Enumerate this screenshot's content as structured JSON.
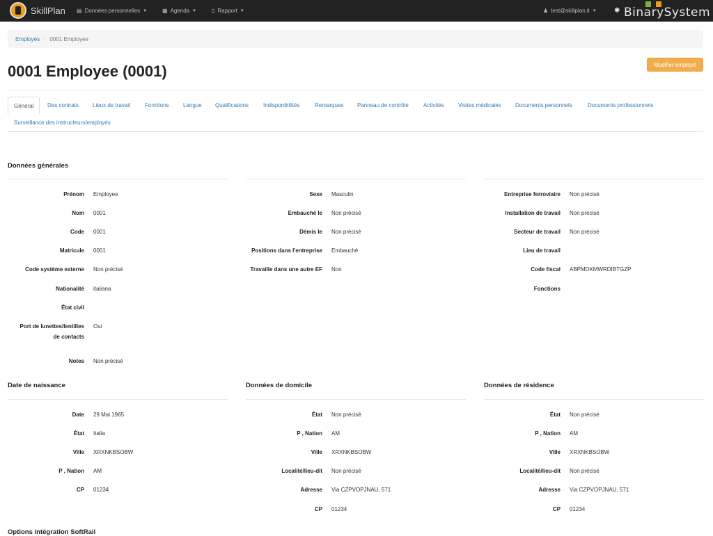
{
  "nav": {
    "brand": "SkillPlan",
    "menus": [
      {
        "icon": "id-card-icon",
        "label": "Données personnelles"
      },
      {
        "icon": "calendar-icon",
        "label": "Agenda"
      },
      {
        "icon": "report-icon",
        "label": "Rapport"
      }
    ],
    "user": "test@skillplan.it",
    "company_logo": "BinarySystem"
  },
  "breadcrumb": {
    "parent": "Employés",
    "separator": "/",
    "current": "0001 Employee"
  },
  "page": {
    "title": "0001 Employee (0001)",
    "edit_button": "Modifier employé"
  },
  "tabs": [
    "Général",
    "Des contrats",
    "Lieux de travail",
    "Fonctions",
    "Langue",
    "Qualifications",
    "Indisponibilités",
    "Remarques",
    "Panneau de contrôle",
    "Activités",
    "Visites médicales",
    "Documents personnels",
    "Documents professionnels",
    "Surveillance des instructeurs/employés"
  ],
  "active_tab": "Général",
  "general": {
    "heading": "Données générales",
    "col1": [
      {
        "label": "Prénom",
        "value": "Employee"
      },
      {
        "label": "Nom",
        "value": "0001"
      },
      {
        "label": "Code",
        "value": "0001"
      },
      {
        "label": "Matricule",
        "value": "0001"
      },
      {
        "label": "Code système externe",
        "value": "Non précisé"
      },
      {
        "label": "Nationalité",
        "value": "italiana"
      },
      {
        "label": "État civil",
        "value": ""
      },
      {
        "label": "Port de lunettes/lentilles",
        "label2": "de contacts",
        "value": "Oui"
      },
      {
        "label": "Notes",
        "value": "Non précisé"
      }
    ],
    "col2": [
      {
        "label": "Sexe",
        "value": "Masculin"
      },
      {
        "label": "Embauché le",
        "value": "Non précisé"
      },
      {
        "label": "Démis le",
        "value": "Non précisé"
      },
      {
        "label": "Positions dans l'entreprise",
        "value": "Embauché"
      },
      {
        "label": "Travaille dans une autre EF",
        "value": "Non"
      }
    ],
    "col3": [
      {
        "label": "Entreprise ferroviaire",
        "value": "Non précisé"
      },
      {
        "label": "Installation de travail",
        "value": "Non précisé"
      },
      {
        "label": "Secteur de travail",
        "value": "Non précisé"
      },
      {
        "label": "Lieu de travail",
        "value": ""
      },
      {
        "label": "Code fiscal",
        "value": "ABPMDKMWRDIBTGZP"
      },
      {
        "label": "Fonctions",
        "value": ""
      }
    ]
  },
  "birth": {
    "heading": "Date de naissance",
    "rows": [
      {
        "label": "Date",
        "value": "29 Mai 1965"
      },
      {
        "label": "État",
        "value": "Italia"
      },
      {
        "label": "Ville",
        "value": "XRXNKBSOBW"
      },
      {
        "label": "P , Nation",
        "value": "AM"
      },
      {
        "label": "CP",
        "value": "01234"
      }
    ]
  },
  "domicile": {
    "heading": "Données de domicile",
    "rows": [
      {
        "label": "État",
        "value": "Non précisé"
      },
      {
        "label": "P , Nation",
        "value": "AM"
      },
      {
        "label": "Ville",
        "value": "XRXNKBSOBW"
      },
      {
        "label": "Localité/lieu-dit",
        "value": "Non précisé"
      },
      {
        "label": "Adresse",
        "value": "Via CZPVOPJNAU, 571"
      },
      {
        "label": "CP",
        "value": "01234"
      }
    ]
  },
  "residence": {
    "heading": "Données de résidence",
    "rows": [
      {
        "label": "État",
        "value": "Non précisé"
      },
      {
        "label": "P , Nation",
        "value": "AM"
      },
      {
        "label": "Ville",
        "value": "XRXNKBSOBW"
      },
      {
        "label": "Localité/lieu-dit",
        "value": "Non précisé"
      },
      {
        "label": "Adresse",
        "value": "Via CZPVOPJNAU, 571"
      },
      {
        "label": "CP",
        "value": "01234"
      }
    ]
  },
  "softrail": {
    "heading": "Options intégration SoftRail"
  }
}
